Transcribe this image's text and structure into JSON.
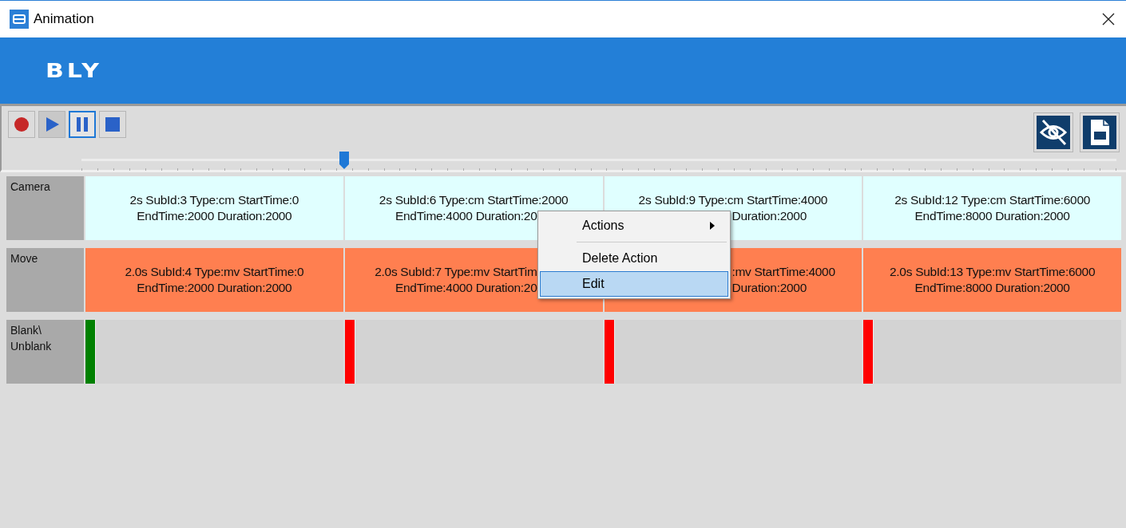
{
  "window": {
    "title": "Animation"
  },
  "header": {
    "logo": "BLY"
  },
  "toolbar": {
    "buttons": [
      {
        "kind": "record",
        "selected": false
      },
      {
        "kind": "play",
        "selected": false
      },
      {
        "kind": "pause",
        "selected": true
      },
      {
        "kind": "stop",
        "selected": false
      }
    ],
    "right_buttons": [
      {
        "kind": "hide"
      },
      {
        "kind": "export"
      }
    ]
  },
  "timeline": {
    "level": 0.254
  },
  "tracks": [
    {
      "label": "Camera",
      "kind": "action",
      "color": "#e0ffff",
      "cells": [
        {
          "lines": [
            {
              "text": "2s SubId:3 Type:cm StartTime:0"
            },
            {
              "text": "EndTime:2000 Duration:2000"
            }
          ]
        },
        {
          "lines": [
            {
              "text": "2s SubId:6 Type:cm StartTime:2000"
            },
            {
              "text": "EndTime:4000 Duration:20",
              "kind": "tail_hidden"
            }
          ]
        },
        {
          "lines": [
            {
              "text": "2s SubId:9 Type:cm StartTime:4000"
            },
            {
              "text": "Duration:2000",
              "kind": "head_hidden"
            }
          ]
        },
        {
          "lines": [
            {
              "text": "2s SubId:12 Type:cm StartTime:6000"
            },
            {
              "text": "EndTime:8000 Duration:2000"
            }
          ]
        }
      ]
    },
    {
      "label": "Move",
      "kind": "action",
      "color": "#ff7f50",
      "cells": [
        {
          "lines": [
            {
              "text": "2.0s SubId:4 Type:mv StartTime:0"
            },
            {
              "text": "EndTime:2000 Duration:2000"
            }
          ]
        },
        {
          "lines": [
            {
              "text": "2.0s SubId:7 Type:mv StartTim",
              "kind": "tail_hidden"
            },
            {
              "text": "EndTime:4000 Duration:20",
              "kind": "tail_hidden"
            }
          ]
        },
        {
          "lines": [
            {
              "text": ":mv StartTime:4000",
              "kind": "head_hidden"
            },
            {
              "text": "Duration:2000",
              "kind": "head_hidden"
            }
          ]
        },
        {
          "lines": [
            {
              "text": "2.0s SubId:13 Type:mv StartTime:6000"
            },
            {
              "text": "EndTime:8000 Duration:2000"
            }
          ]
        }
      ]
    },
    {
      "label": "Blank\\ Unblank",
      "kind": "marker",
      "cells": [
        {
          "color": "#008000"
        },
        {
          "color": "#ff0000"
        },
        {
          "color": "#ff0000"
        },
        {
          "color": "#ff0000"
        }
      ]
    }
  ],
  "context_menu": {
    "items": [
      {
        "kind": "item",
        "label": "Actions",
        "submenu": true,
        "selected": false
      },
      {
        "kind": "separator"
      },
      {
        "kind": "item",
        "label": "Delete Action",
        "submenu": false,
        "selected": false
      },
      {
        "kind": "item",
        "label": "Edit",
        "submenu": false,
        "selected": true
      }
    ]
  }
}
